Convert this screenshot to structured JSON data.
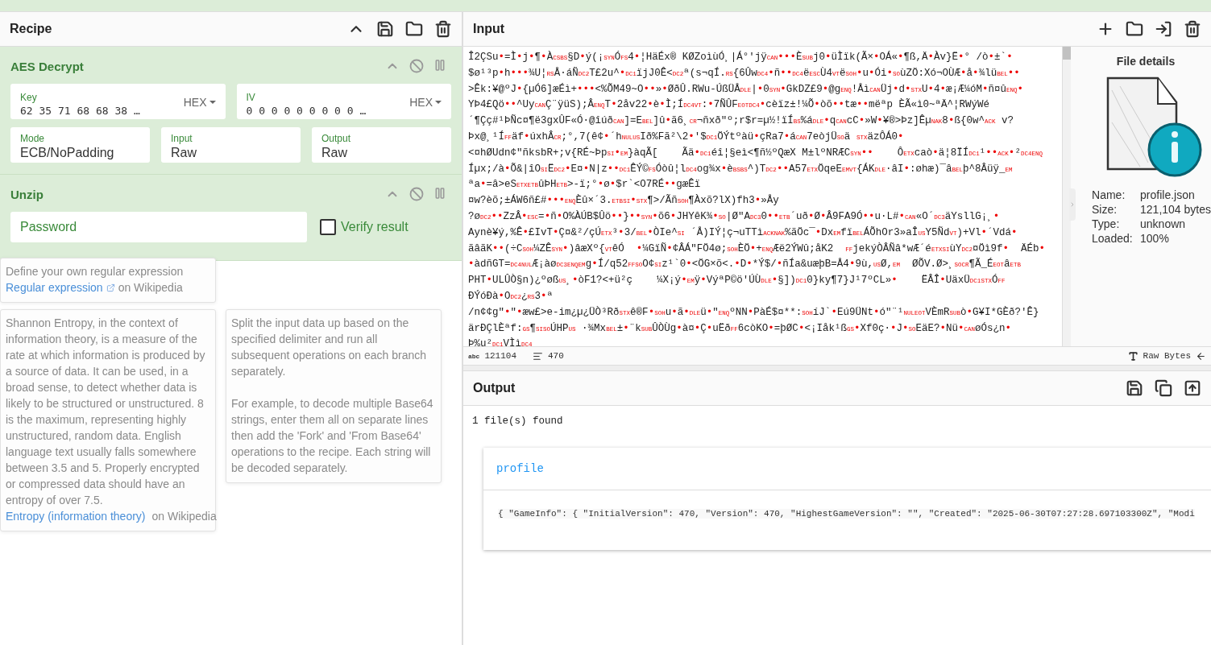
{
  "recipe": {
    "title": "Recipe",
    "operations": [
      {
        "kind": "aes",
        "title": "AES Decrypt",
        "key": {
          "label": "Key",
          "value": "62 35 71 68 68 38 …",
          "format": "HEX"
        },
        "iv": {
          "label": "IV",
          "value": "0 0 0 0 0 0 0 0 0 …",
          "format": "HEX"
        },
        "mode": {
          "label": "Mode",
          "value": "ECB/NoPadding"
        },
        "input": {
          "label": "Input",
          "value": "Raw"
        },
        "output": {
          "label": "Output",
          "value": "Raw"
        }
      },
      {
        "kind": "unzip",
        "title": "Unzip",
        "password": {
          "placeholder": "Password"
        },
        "verify": {
          "label": "Verify result",
          "checked": false
        }
      }
    ]
  },
  "popovers": [
    {
      "kind": "regex",
      "lines": [
        "Define your own regular expression"
      ],
      "link": "Regular expression",
      "link_suffix": "on Wikipedia"
    },
    {
      "kind": "entropy",
      "text": "Shannon Entropy, in the context of information theory, is a measure of the rate at which information is produced by a source of data. It can be used, in a broad sense, to detect whether data is likely to be structured or unstructured. 8 is the maximum, representing highly unstructured, random data. English language text usually falls somewhere between 3.5 and 5. Properly encrypted or compressed data should have an entropy of over 7.5.",
      "link": "Entropy (information theory)",
      "link_suffix": "on Wikipedia"
    },
    {
      "kind": "fork",
      "text": "Split the input data up based on the specified delimiter and run all subsequent operations on each branch separately.\n\nFor example, to decode multiple Base64 strings, enter them all on separate lines then add the 'Fork' and 'From Base64' operations to the recipe. Each string will be decoded separately."
    }
  ],
  "input": {
    "title": "Input",
    "lines": [
      [
        "Î2ÇSu",
        {
          "control": "•"
        },
        "=Ì",
        {
          "control": "•"
        },
        "j",
        {
          "control": "•"
        },
        "¶",
        {
          "control": "•"
        },
        "À",
        {
          "control": "CS"
        },
        {
          "control": "BS"
        },
        "§D",
        {
          "control": "•"
        },
        "ý(¡",
        {
          "control": "SYN"
        },
        "Ó",
        {
          "control": "FS"
        },
        "4",
        {
          "control": "•"
        },
        "¦HäÉx® KØZoìùÓ¸|Á°'jÿ",
        {
          "control": "CAN"
        },
        {
          "control": "•"
        },
        {
          "control": "•"
        },
        {
          "control": "•"
        },
        "È",
        {
          "control": "SUB"
        },
        "j0",
        {
          "control": "•"
        },
        "üÌïk(Ã×",
        {
          "control": "•"
        },
        "OÁ«",
        {
          "control": "•"
        },
        "¶ß,Ä",
        {
          "control": "•"
        },
        "Àv}Ë",
        {
          "control": "•"
        },
        "° /ò",
        {
          "control": "•"
        },
        "±`",
        {
          "control": "•"
        }
      ],
      [
        "$ø¹³p",
        {
          "control": "•"
        },
        "h",
        {
          "control": "•"
        },
        {
          "control": "•"
        },
        {
          "control": "•"
        },
        "¾U¦",
        {
          "control": "RS"
        },
        "Å·áÑ",
        {
          "control": "DC2"
        },
        "T£2u^",
        {
          "control": "•"
        },
        {
          "control": "DC1"
        },
        "ïjJ0Ê<",
        {
          "control": "DC2"
        },
        "ª(s¬qÍ.",
        {
          "control": "RS"
        },
        "{6Ûw",
        {
          "control": "DC4"
        },
        {
          "control": "•"
        },
        "ñ",
        {
          "control": "•"
        },
        {
          "control": "•"
        },
        {
          "control": "DC4"
        },
        "ë",
        {
          "control": "ESC"
        },
        "Ù4",
        {
          "control": "VT"
        },
        "ë",
        {
          "control": "SOH"
        },
        {
          "control": "•"
        },
        "u",
        {
          "control": "•"
        },
        "Ói",
        {
          "control": "•"
        },
        {
          "control": "SO"
        },
        "ùZÖ:Xó¬OÙÆ",
        {
          "control": "•"
        },
        "å",
        {
          "control": "•"
        },
        "¾lü",
        {
          "control": "BEL"
        },
        {
          "control": "•"
        },
        {
          "control": "•"
        }
      ],
      [
        ">Êk:¥@ºJ",
        {
          "control": "•"
        },
        "{µÓ6]æÉì+",
        {
          "control": "•"
        },
        {
          "control": "•"
        },
        {
          "control": "•"
        },
        "<%ÕM49~O",
        {
          "control": "•"
        },
        {
          "control": "•"
        },
        "»",
        {
          "control": "•"
        },
        "ØðÛ.RWu-ÚßÜÅ",
        {
          "control": "DLE"
        },
        "|",
        {
          "control": "•"
        },
        "0",
        {
          "control": "SYN"
        },
        {
          "control": "•"
        },
        "GkDZ£9",
        {
          "control": "•"
        },
        "@g",
        {
          "control": "ENQ"
        },
        "!Åì",
        {
          "control": "CAN"
        },
        "Üj",
        {
          "control": "•"
        },
        "d",
        {
          "control": "•"
        },
        {
          "control": "STX"
        },
        "U",
        {
          "control": "•"
        },
        "4",
        {
          "control": "•"
        },
        "æ¡Æ¼óM",
        {
          "control": "•"
        },
        "ñ¤û",
        {
          "control": "ENQ"
        },
        {
          "control": "•"
        }
      ],
      [
        "YÞ4£Qö",
        {
          "control": "•"
        },
        {
          "control": "•"
        },
        "^Uy",
        {
          "control": "CAN"
        },
        "Ç¨ÿüS);Â",
        {
          "control": "ENQ"
        },
        "T",
        {
          "control": "•"
        },
        "2åv22",
        {
          "control": "•"
        },
        "è",
        {
          "control": "•"
        },
        "Ì;Í",
        {
          "control": "DC4"
        },
        {
          "control": "VT"
        },
        ":",
        {
          "control": "•"
        },
        "7ÑÛF",
        {
          "control": "EOT"
        },
        {
          "control": "DC4"
        },
        {
          "control": "•"
        },
        "cèïz±!¼Õ",
        {
          "control": "•"
        },
        "òõ",
        {
          "control": "•"
        },
        {
          "control": "•"
        },
        "tæ",
        {
          "control": "•"
        },
        {
          "control": "•"
        },
        "mëªp ÈÃ",
        "«ì0~ªÄ^¦RWýWé"
      ],
      [
        "´¶Çç#¹ÞÑc¤¶ë3gxÛF«Ó·@îúð",
        {
          "control": "CAN"
        },
        "]=E",
        {
          "control": "BEL"
        },
        "]û",
        {
          "control": "•"
        },
        "ã6¸",
        {
          "control": "CR"
        },
        "¬ñxð\"º;r$r=µ½!ïÍ",
        {
          "control": "BS"
        },
        "%á",
        {
          "control": "DLE"
        },
        {
          "control": "•"
        },
        "q",
        {
          "control": "CAN"
        },
        "cC",
        {
          "control": "•"
        },
        "»W",
        {
          "control": "•"
        },
        "¥®>Þz]Êµ",
        {
          "control": "NAK"
        },
        "8",
        {
          "control": "•"
        },
        "ß{0w^",
        {
          "control": "ACK"
        },
        " v?"
      ],
      [
        "Þx@¸¹Í",
        {
          "control": "FF"
        },
        "äf",
        {
          "control": "•"
        },
        "úxhÂ",
        {
          "control": "CR"
        },
        ";°,7(ê¢",
        {
          "control": "•"
        },
        "´h",
        {
          "control": "NUL"
        },
        {
          "control": "US"
        },
        "Ið%Fã²\\2",
        {
          "control": "•"
        },
        "'$",
        {
          "control": "DC1"
        },
        "ÖÝtºàü",
        {
          "control": "•"
        },
        "çRa7",
        {
          "control": "•"
        },
        "á",
        {
          "control": "CAN"
        },
        "7eòjÜ",
        {
          "control": "SO"
        },
        "ä ",
        {
          "control": "STX"
        },
        "äzÔÁ0",
        {
          "control": "•"
        }
      ],
      [
        "<¤hØUdn¢\"ñksbR+;v{RÉ~Þp",
        {
          "control": "SI"
        },
        {
          "control": "•"
        },
        {
          "control": "EM"
        },
        "}àqÃ[    Ãä",
        {
          "control": "•"
        },
        {
          "control": "DC1"
        },
        "éî¦§eì<¶ñ½ºQæX M±lºNRÆC",
        {
          "control": "SYN"
        },
        {
          "control": "•"
        },
        {
          "control": "•"
        },
        "    Ô",
        {
          "control": "ETX"
        },
        "caò",
        {
          "control": "•"
        },
        "ä¦8ÏÍ",
        {
          "control": "DC1"
        },
        "¹",
        {
          "control": "•"
        },
        {
          "control": "•"
        },
        {
          "control": "ACK"
        },
        {
          "control": "•"
        },
        "²",
        {
          "control": "DC4"
        },
        {
          "control": "ENQ"
        }
      ],
      [
        "Íµx;/à",
        {
          "control": "•"
        },
        "Õ&|îO",
        {
          "control": "SI"
        },
        "Ë",
        {
          "control": "DC2"
        },
        {
          "control": "•"
        },
        "E¤",
        {
          "control": "•"
        },
        "N|z",
        {
          "control": "•"
        },
        {
          "control": "•"
        },
        {
          "control": "DC1"
        },
        "ÊÝ©",
        {
          "control": "FS"
        },
        "Óòû¦l",
        {
          "control": "DC4"
        },
        "og¾x",
        {
          "control": "•"
        },
        "è",
        {
          "control": "BS"
        },
        {
          "control": "BS"
        },
        "^)T",
        {
          "control": "DC2"
        },
        {
          "control": "•"
        },
        {
          "control": "•"
        },
        "A57",
        {
          "control": "ETX"
        },
        "ÖqeE",
        {
          "control": "EM"
        },
        {
          "control": "VT"
        },
        "{ÁK",
        {
          "control": "DLE"
        },
        "·âI",
        {
          "control": "•"
        },
        ":øhæ)¯â",
        {
          "control": "BEL"
        },
        "þ^8Âüÿ_",
        {
          "control": "EM"
        }
      ],
      [
        "ªa",
        {
          "control": "•"
        },
        "=â>eS",
        {
          "control": "ETX"
        },
        {
          "control": "ETB"
        },
        "ûÞH",
        {
          "control": "ETB"
        },
        ">-ï;°",
        {
          "control": "•"
        },
        "ø",
        {
          "control": "•"
        },
        "$r`<O7RÉ",
        {
          "control": "•"
        },
        {
          "control": "•"
        },
        "gæÊï"
      ],
      [
        "¤w?èõ;±ÁW6ñ£#",
        {
          "control": "•"
        },
        {
          "control": "•"
        },
        {
          "control": "•"
        },
        {
          "control": "ENQ"
        },
        "Èû×´3.",
        {
          "control": "ETB"
        },
        {
          "control": "SI"
        },
        {
          "control": "•"
        },
        {
          "control": "STX"
        },
        "¶>/Ãñ",
        {
          "control": "SOH"
        },
        "¶Àxõ?lX)fh3",
        {
          "control": "•"
        },
        "»Åy"
      ],
      [
        "?ø",
        {
          "control": "DC2"
        },
        {
          "control": "•"
        },
        {
          "control": "•"
        },
        "ZzÂ",
        {
          "control": "•"
        },
        {
          "control": "ESC"
        },
        "=",
        {
          "control": "•"
        },
        "ñ",
        {
          "control": "•"
        },
        "O%ÀÚB$Ûö",
        {
          "control": "•"
        },
        {
          "control": "•"
        },
        "}",
        {
          "control": "•"
        },
        {
          "control": "•"
        },
        {
          "control": "SYN"
        },
        {
          "control": "•"
        },
        "õ6",
        {
          "control": "•"
        },
        "JHYêK¾",
        {
          "control": "•"
        },
        {
          "control": "SO"
        },
        "|Ø\"A",
        {
          "control": "DC3"
        },
        "0",
        {
          "control": "•"
        },
        {
          "control": "•"
        },
        {
          "control": "ETB"
        },
        "´uð",
        {
          "control": "•"
        },
        "Ø",
        {
          "control": "•"
        },
        "Â9FA9Ó",
        {
          "control": "•"
        },
        {
          "control": "•"
        },
        "u·L#",
        {
          "control": "•"
        },
        {
          "control": "CAN"
        },
        "«O´",
        {
          "control": "DC3"
        },
        "äYsllG¡¸",
        {
          "control": "•"
        }
      ],
      [
        "Aynè¥ý,%Ê",
        {
          "control": "•"
        },
        "£IvT",
        {
          "control": "•"
        },
        "Ç¤&²/çÚ",
        {
          "control": "ETX"
        },
        "³",
        {
          "control": "•"
        },
        "3/",
        {
          "control": "BEL"
        },
        {
          "control": "•"
        },
        "ÒIe^",
        {
          "control": "SI"
        },
        " ´Å)IÝ¦ç¬uTTì",
        {
          "control": "ACK"
        },
        {
          "control": "NAK"
        },
        "%ãÖc¯",
        {
          "control": "•"
        },
        "Dx",
        {
          "control": "EM"
        },
        "fï",
        {
          "control": "BEL"
        },
        "ÁÕhOr3»aÎ",
        {
          "control": "US"
        },
        "Y5Ñd",
        {
          "control": "VT"
        },
        ")+Vl",
        {
          "control": "•"
        },
        "´Vdá",
        {
          "control": "•"
        }
      ],
      [
        "ãâãK",
        {
          "control": "•"
        },
        {
          "control": "•"
        },
        "(÷C",
        {
          "control": "SOH"
        },
        "¼ZÊ",
        {
          "control": "SYN"
        },
        {
          "control": "•"
        },
        ")âæXº{",
        {
          "control": "VT"
        },
        "êÓ  ",
        {
          "control": "•"
        },
        "¼GïÑ",
        {
          "control": "•"
        },
        "¢ÂÁ\"FÖ4ø;",
        {
          "control": "SOH"
        },
        "ÈÖ",
        {
          "control": "•"
        },
        "+",
        {
          "control": "ENQ"
        },
        "Æë2ÝWû;åK2  ",
        {
          "control": "FF"
        },
        "jekýÒÂÑâ*wÆ´é",
        {
          "control": "ETX"
        },
        {
          "control": "SI"
        },
        "ùY",
        {
          "control": "DC2"
        },
        "¤Öì9f",
        {
          "control": "•"
        },
        "  ÄÉb",
        {
          "control": "•"
        }
      ],
      [
        {
          "control": "•"
        },
        "àdñGT=",
        {
          "control": "DC4"
        },
        {
          "control": "NUL"
        },
        "Æ¡àø",
        {
          "control": "DC3"
        },
        {
          "control": "ENQ"
        },
        {
          "control": "EM"
        },
        "g",
        {
          "control": "•"
        },
        "Í/q52",
        {
          "control": "FF"
        },
        {
          "control": "SO"
        },
        "O¢",
        {
          "control": "SI"
        },
        "z¹`0",
        {
          "control": "•"
        },
        "<ÖG×õ<.",
        {
          "control": "•"
        },
        "D",
        {
          "control": "•"
        },
        "*Ý$/",
        {
          "control": "•"
        },
        "ñÍa&uæþB=Å4",
        {
          "control": "•"
        },
        "9ù,",
        {
          "control": "US"
        },
        "Ø,",
        {
          "control": "EM"
        },
        "  ØÕV.Ø>¸",
        {
          "control": "SO"
        },
        {
          "control": "CR"
        },
        "¶Ã_É",
        {
          "control": "EOT"
        },
        "â",
        {
          "control": "ETB"
        }
      ],
      [
        "PHT",
        {
          "control": "•"
        },
        "ULÛÒ§n)¿ºøß",
        {
          "control": "US"
        },
        "¸",
        {
          "control": "•"
        },
        "òF1?<+ü²ç    ¼X¡ý",
        {
          "control": "•"
        },
        {
          "control": "EM"
        },
        "ÿ",
        {
          "control": "•"
        },
        "VýªP©ö'ÚÙ",
        {
          "control": "DLE"
        },
        {
          "control": "•"
        },
        "§])",
        {
          "control": "DC1"
        },
        "0}ky¶7}J¹7ºCL»",
        {
          "control": "•"
        },
        "    ËÂÎ",
        {
          "control": "•"
        },
        "UäxÜ",
        {
          "control": "DC1"
        },
        {
          "control": "STX"
        },
        "Ó",
        {
          "control": "FF"
        }
      ],
      [
        "ÐÝóÐà",
        {
          "control": "•"
        },
        "O",
        {
          "control": "DC2"
        },
        "¿",
        {
          "control": "RS"
        },
        "3",
        {
          "control": "•"
        },
        "ª"
      ],
      [
        "/n¢¢g\"",
        {
          "control": "•"
        },
        "\"",
        {
          "control": "•"
        },
        "æw£>e-im¿µ¿ÜÒ³Rð",
        {
          "control": "STX"
        },
        "ê®F",
        {
          "control": "•"
        },
        {
          "control": "SOH"
        },
        "u",
        {
          "control": "•"
        },
        "ã",
        {
          "control": "•"
        },
        {
          "control": "DLE"
        },
        "ü",
        {
          "control": "•"
        },
        "\"",
        {
          "control": "ENQ"
        },
        "ºNN",
        {
          "control": "•"
        },
        "PàÉ$¤**:",
        {
          "control": "SOH"
        },
        "íJ`",
        {
          "control": "•"
        },
        "Eú9ÜNt",
        {
          "control": "•"
        },
        "ó\"¨¹",
        {
          "control": "NUL"
        },
        {
          "control": "EOT"
        },
        "VÈmR",
        {
          "control": "SUB"
        },
        "ò",
        {
          "control": "•"
        },
        "G¥I*GÈð?'Ê}"
      ],
      [
        "ärÐÇlÈªf:",
        {
          "control": "GS"
        },
        "¶",
        {
          "control": "SI"
        },
        {
          "control": "SO"
        },
        "ÚHP",
        {
          "control": "US"
        },
        " ·¾Mx",
        {
          "control": "BEL"
        },
        "±",
        {
          "control": "•"
        },
        "¨k",
        {
          "control": "SUB"
        },
        "ÛÒÙg",
        {
          "control": "•"
        },
        "à¤",
        {
          "control": "•"
        },
        "Ç",
        {
          "control": "•"
        },
        "uËð",
        {
          "control": "FF"
        },
        "6còKO",
        {
          "control": "•"
        },
        "=þØC",
        {
          "control": "•"
        },
        "<¡Iåk¹ß",
        {
          "control": "GS"
        },
        {
          "control": "•"
        },
        "Xf0ç·",
        {
          "control": "•"
        },
        "J",
        {
          "control": "•"
        },
        {
          "control": "SO"
        },
        "EäE?",
        {
          "control": "•"
        },
        "Nü",
        {
          "control": "•"
        },
        {
          "control": "CAN"
        },
        "øÓs¿n",
        {
          "control": "•"
        }
      ],
      [
        "Þ%u²",
        {
          "control": "DC1"
        },
        "VÌì",
        {
          "control": "DC4"
        }
      ]
    ],
    "status": {
      "length_mark": "abc",
      "length": "121104",
      "lines": "470",
      "encoding": "Raw Bytes"
    },
    "file_details": {
      "title": "File details",
      "fields": [
        {
          "label": "Name:",
          "value": "profile.json"
        },
        {
          "label": "Size:",
          "value": "121,104 bytes"
        },
        {
          "label": "Type:",
          "value": "unknown"
        },
        {
          "label": "Loaded:",
          "value": "100%"
        }
      ]
    }
  },
  "output": {
    "title": "Output",
    "summary": "1 file(s) found",
    "files": [
      {
        "name": "profile",
        "preview": "{ \"GameInfo\": { \"InitialVersion\": 470, \"Version\": 470, \"HighestGameVersion\": \"\", \"Created\": \"2025-06-30T07:27:28.697103300Z\", \"Modi"
      }
    ]
  }
}
